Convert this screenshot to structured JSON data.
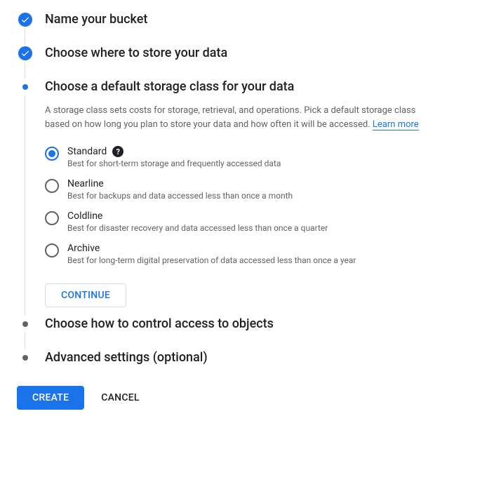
{
  "steps": {
    "name_bucket": {
      "title": "Name your bucket"
    },
    "choose_location": {
      "title": "Choose where to store your data"
    },
    "storage_class": {
      "title": "Choose a default storage class for your data",
      "description": "A storage class sets costs for storage, retrieval, and operations. Pick a default storage class based on how long you plan to store your data and how often it will be accessed. ",
      "learn_more": "Learn more",
      "options": [
        {
          "label": "Standard",
          "desc": "Best for short-term storage and frequently accessed data",
          "selected": true,
          "help": true
        },
        {
          "label": "Nearline",
          "desc": "Best for backups and data accessed less than once a month",
          "selected": false,
          "help": false
        },
        {
          "label": "Coldline",
          "desc": "Best for disaster recovery and data accessed less than once a quarter",
          "selected": false,
          "help": false
        },
        {
          "label": "Archive",
          "desc": "Best for long-term digital preservation of data accessed less than once a year",
          "selected": false,
          "help": false
        }
      ],
      "continue_label": "CONTINUE"
    },
    "control_access": {
      "title": "Choose how to control access to objects"
    },
    "advanced": {
      "title": "Advanced settings (optional)"
    }
  },
  "footer": {
    "create_label": "CREATE",
    "cancel_label": "CANCEL"
  }
}
